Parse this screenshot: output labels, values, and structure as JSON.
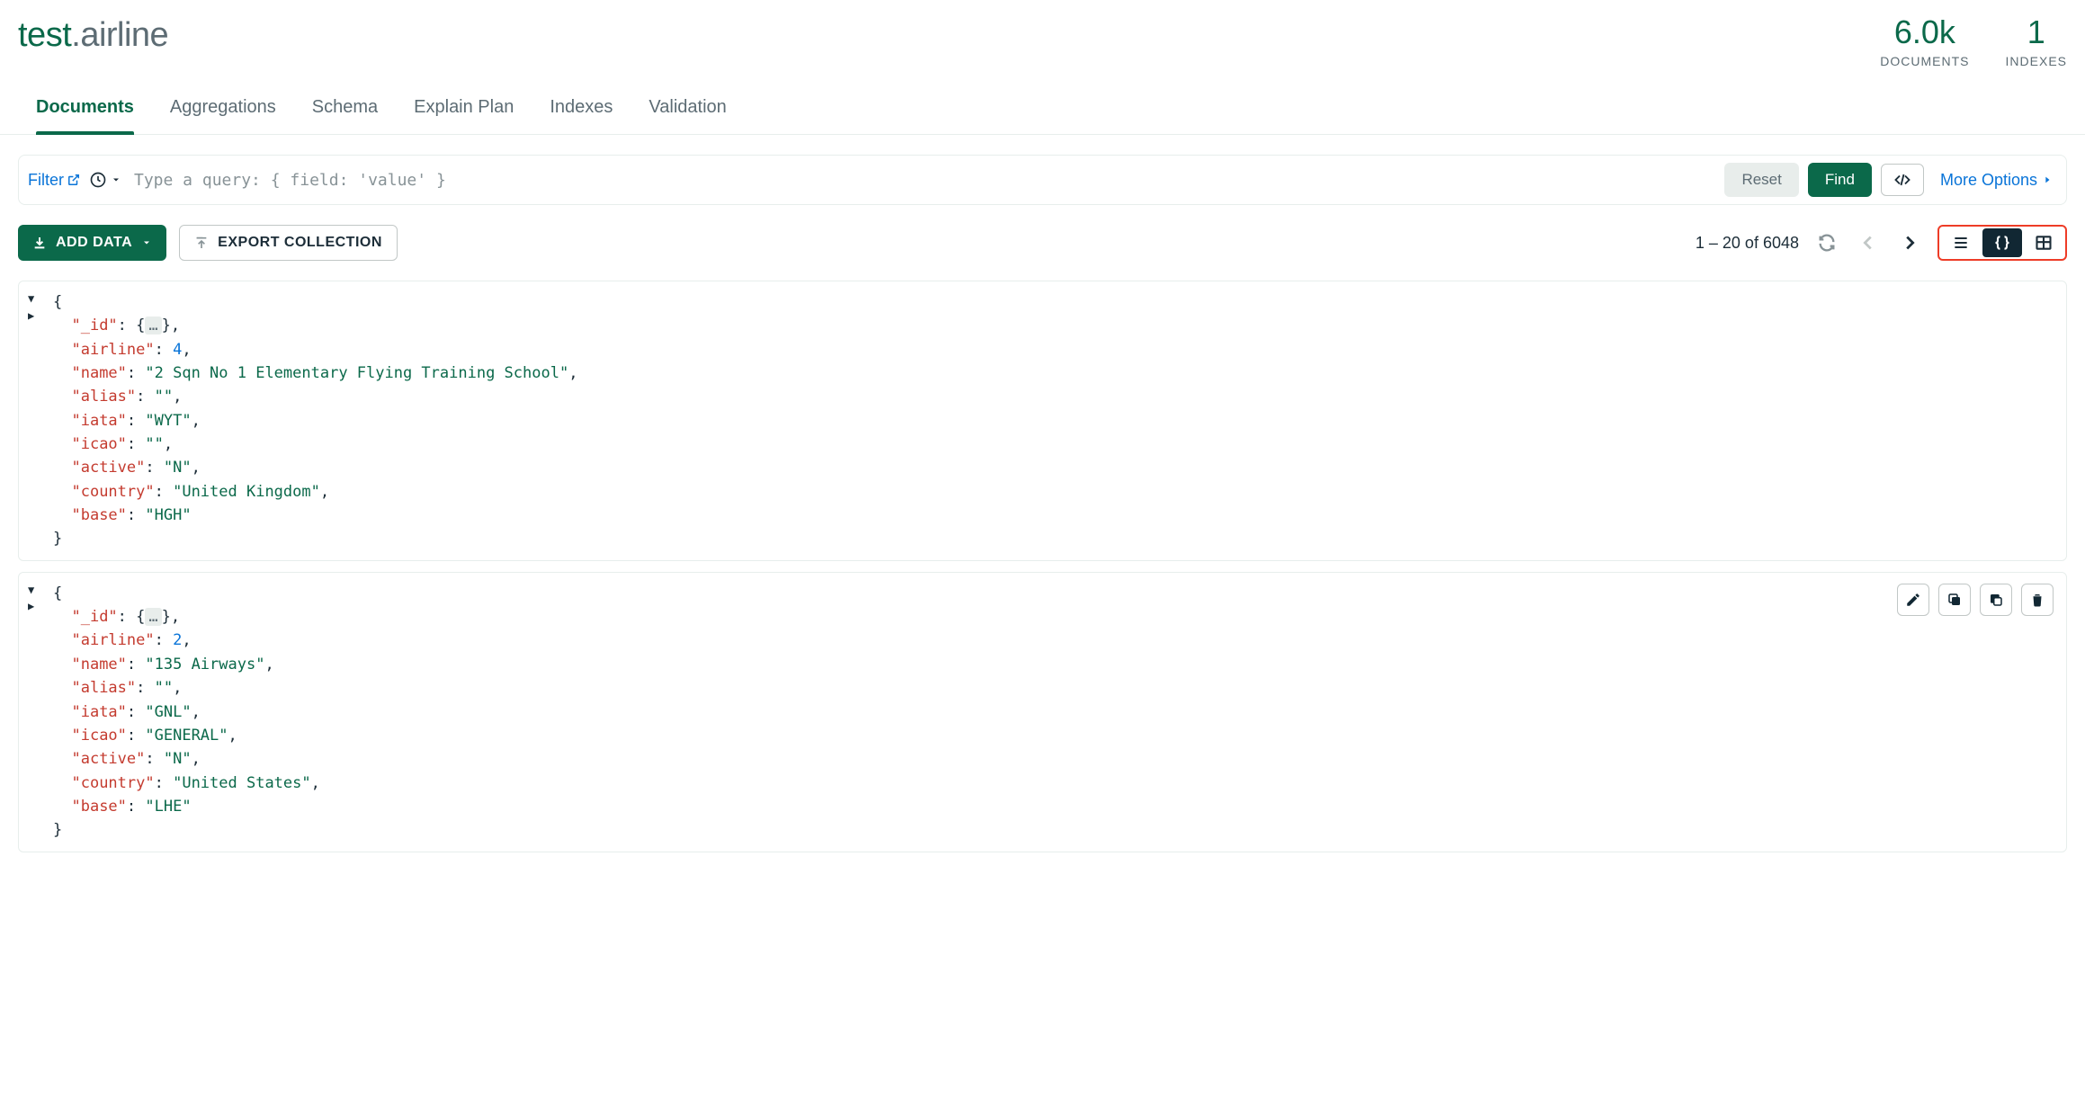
{
  "header": {
    "db": "test",
    "coll": "airline",
    "stats": {
      "documents_value": "6.0k",
      "documents_label": "DOCUMENTS",
      "indexes_value": "1",
      "indexes_label": "INDEXES"
    }
  },
  "tabs": [
    "Documents",
    "Aggregations",
    "Schema",
    "Explain Plan",
    "Indexes",
    "Validation"
  ],
  "tabs_active_index": 0,
  "filterbar": {
    "filter_label": "Filter",
    "placeholder": "Type a query: { field: 'value' }",
    "reset_label": "Reset",
    "find_label": "Find",
    "more_options_label": "More Options"
  },
  "toolbar": {
    "add_data_label": "ADD DATA",
    "export_label": "EXPORT COLLECTION",
    "paging_text": "1 – 20 of 6048"
  },
  "documents": [
    {
      "show_actions": false,
      "fields": {
        "airline": 4,
        "name": "2 Sqn No 1 Elementary Flying Training School",
        "alias": "",
        "iata": "WYT",
        "icao": "",
        "active": "N",
        "country": "United Kingdom",
        "base": "HGH"
      }
    },
    {
      "show_actions": true,
      "fields": {
        "airline": 2,
        "name": "135 Airways",
        "alias": "",
        "iata": "GNL",
        "icao": "GENERAL",
        "active": "N",
        "country": "United States",
        "base": "LHE"
      }
    }
  ]
}
